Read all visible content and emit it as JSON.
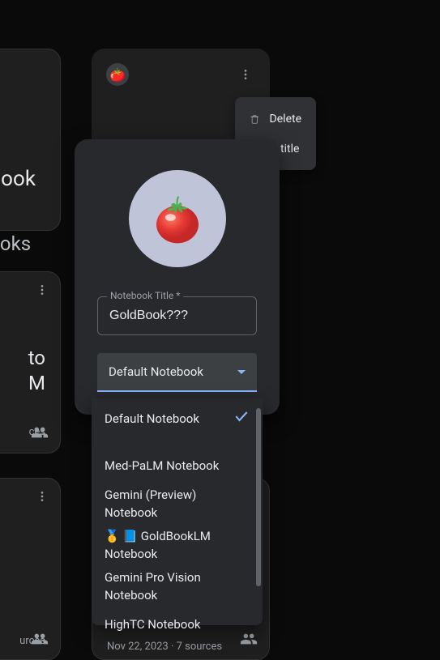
{
  "bg": {
    "card1_title": "ook",
    "notebooks_label": "ebooks",
    "card2_title": "to\nM",
    "card2_sources": "ces",
    "card3_sources": "urces",
    "card4_sources": "Nov 22, 2023 · 7 sources"
  },
  "context_menu": {
    "delete": "Delete",
    "edit_partial": "t title"
  },
  "dialog": {
    "tomato_emoji": "🍅",
    "input_label": "Notebook Title *",
    "input_value": "GoldBook???",
    "select_value": "Default Notebook"
  },
  "dropdown": {
    "items": [
      {
        "label": "Default Notebook",
        "selected": true
      },
      {
        "label": "Med-PaLM Notebook",
        "selected": false
      },
      {
        "label": "Gemini (Preview) Notebook",
        "selected": false
      },
      {
        "label": "🥇 📘 GoldBookLM Notebook",
        "selected": false
      },
      {
        "label": "Gemini Pro Vision Notebook",
        "selected": false
      },
      {
        "label": "HighTC Notebook",
        "selected": false
      }
    ]
  },
  "colors": {
    "accent": "#8ab4f8",
    "surface": "#28292c",
    "bg": "#0a0a0a"
  }
}
